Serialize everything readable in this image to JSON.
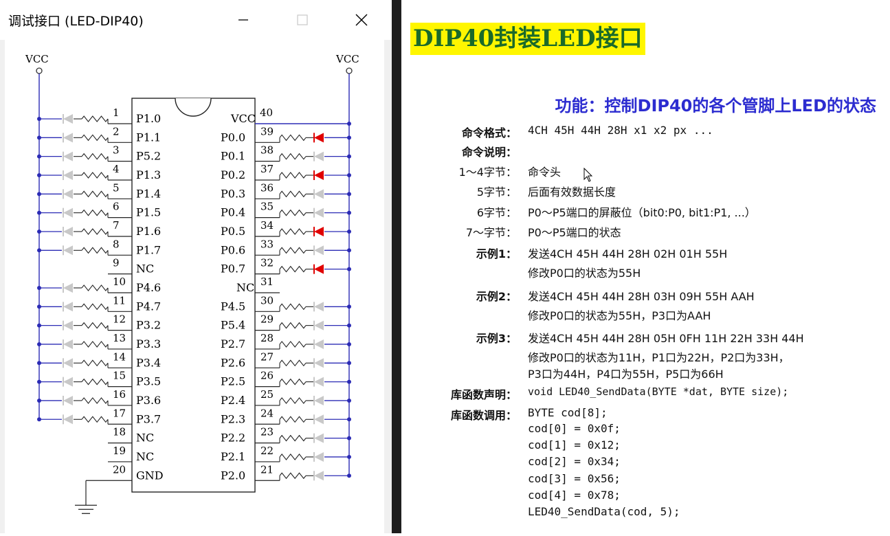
{
  "window": {
    "title": "调试接口 (LED-DIP40)"
  },
  "schematic": {
    "vcc_left": "VCC",
    "vcc_right": "VCC",
    "chip_vcc": "VCC",
    "left_pins": [
      {
        "num": "1",
        "name": "P1.0",
        "led": true
      },
      {
        "num": "2",
        "name": "P1.1",
        "led": true
      },
      {
        "num": "3",
        "name": "P5.2",
        "led": true
      },
      {
        "num": "4",
        "name": "P1.3",
        "led": true
      },
      {
        "num": "5",
        "name": "P1.4",
        "led": true
      },
      {
        "num": "6",
        "name": "P1.5",
        "led": true
      },
      {
        "num": "7",
        "name": "P1.6",
        "led": true
      },
      {
        "num": "8",
        "name": "P1.7",
        "led": true
      },
      {
        "num": "9",
        "name": "NC",
        "led": false
      },
      {
        "num": "10",
        "name": "P4.6",
        "led": true
      },
      {
        "num": "11",
        "name": "P4.7",
        "led": true
      },
      {
        "num": "12",
        "name": "P3.2",
        "led": true
      },
      {
        "num": "13",
        "name": "P3.3",
        "led": true
      },
      {
        "num": "14",
        "name": "P3.4",
        "led": true
      },
      {
        "num": "15",
        "name": "P3.5",
        "led": true
      },
      {
        "num": "16",
        "name": "P3.6",
        "led": true
      },
      {
        "num": "17",
        "name": "P3.7",
        "led": true
      },
      {
        "num": "18",
        "name": "NC",
        "led": false
      },
      {
        "num": "19",
        "name": "NC",
        "led": false
      },
      {
        "num": "20",
        "name": "GND",
        "led": false
      }
    ],
    "right_pins": [
      {
        "num": "39",
        "name": "P0.0",
        "led": "on"
      },
      {
        "num": "38",
        "name": "P0.1",
        "led": "off"
      },
      {
        "num": "37",
        "name": "P0.2",
        "led": "on"
      },
      {
        "num": "36",
        "name": "P0.3",
        "led": "off"
      },
      {
        "num": "35",
        "name": "P0.4",
        "led": "off"
      },
      {
        "num": "34",
        "name": "P0.5",
        "led": "on"
      },
      {
        "num": "33",
        "name": "P0.6",
        "led": "off"
      },
      {
        "num": "32",
        "name": "P0.7",
        "led": "on"
      },
      {
        "num": "31",
        "name": "NC",
        "led": "none"
      },
      {
        "num": "30",
        "name": "P4.5",
        "led": "off"
      },
      {
        "num": "29",
        "name": "P5.4",
        "led": "off"
      },
      {
        "num": "28",
        "name": "P2.7",
        "led": "off"
      },
      {
        "num": "27",
        "name": "P2.6",
        "led": "off"
      },
      {
        "num": "26",
        "name": "P2.5",
        "led": "off"
      },
      {
        "num": "25",
        "name": "P2.4",
        "led": "off"
      },
      {
        "num": "24",
        "name": "P2.3",
        "led": "off"
      },
      {
        "num": "23",
        "name": "P2.2",
        "led": "off"
      },
      {
        "num": "22",
        "name": "P2.1",
        "led": "off"
      },
      {
        "num": "21",
        "name": "P2.0",
        "led": "off"
      }
    ],
    "pin40": "40",
    "colors": {
      "wire": "#2b2bb5",
      "led_on": "#e00000",
      "led_off": "#c8c8c8"
    }
  },
  "doc": {
    "heading": "DIP40封装LED接口",
    "function": "功能：控制DIP40的各个管脚上LED的状态",
    "cmd_format_label": "命令格式：",
    "cmd_format_value": "4CH 45H 44H 28H x1 x2 px ...",
    "cmd_desc_label": "命令说明：",
    "bytes": [
      {
        "label": "1～4字节：",
        "value": "命令头"
      },
      {
        "label": "5字节：",
        "value": "后面有效数据长度"
      },
      {
        "label": "6字节：",
        "value": "P0～P5端口的屏蔽位（bit0:P0, bit1:P1, ...）"
      },
      {
        "label": "7～字节：",
        "value": "P0～P5端口的状态"
      }
    ],
    "example1_label": "示例1：",
    "example1_line1": "发送4CH 45H 44H 28H 02H 01H 55H",
    "example1_line2": "修改P0口的状态为55H",
    "example2_label": "示例2：",
    "example2_line1": "发送4CH 45H 44H 28H 03H 09H 55H AAH",
    "example2_line2": "修改P0口的状态为55H，P3口为AAH",
    "example3_label": "示例3：",
    "example3_line1": "发送4CH 45H 44H 28H 05H 0FH 11H 22H 33H 44H",
    "example3_line2": "修改P0口的状态为11H，P1口为22H，P2口为33H，",
    "example3_line3": "P3口为44H，P4口为55H，P5口为66H",
    "decl_label": "库函数声明：",
    "decl_value": "void LED40_SendData(BYTE *dat, BYTE size);",
    "call_label": "库函数调用：",
    "call_lines": [
      "BYTE cod[8];",
      "cod[0] = 0x0f;",
      "cod[1] = 0x12;",
      "cod[2] = 0x34;",
      "cod[3] = 0x56;",
      "cod[4] = 0x78;",
      "LED40_SendData(cod, 5);"
    ]
  }
}
